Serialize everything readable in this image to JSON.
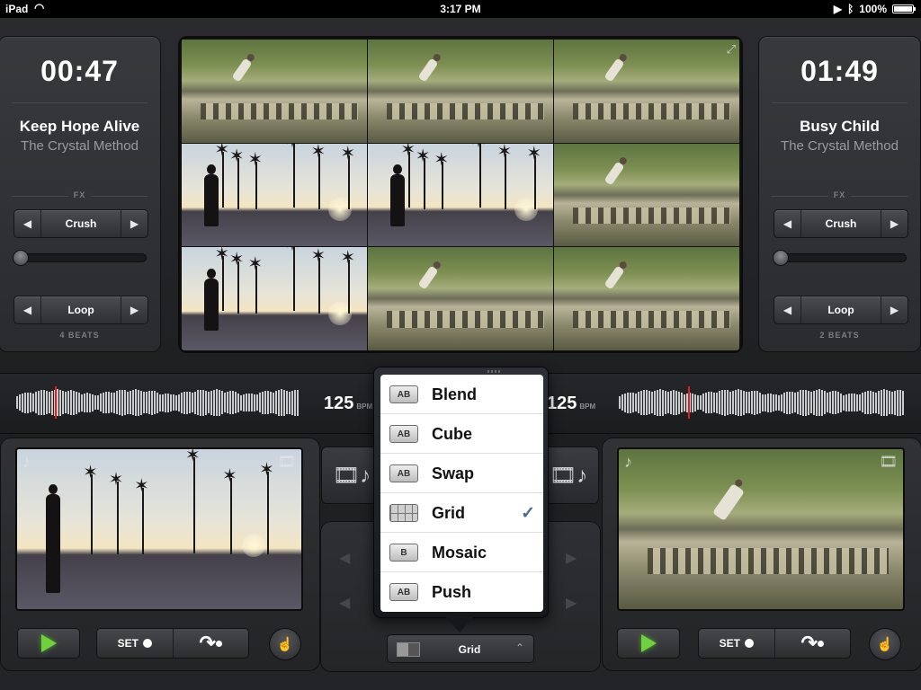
{
  "status_bar": {
    "device": "iPad",
    "time": "3:17 PM",
    "battery": "100%"
  },
  "deck_left": {
    "time": "00:47",
    "title": "Keep Hope Alive",
    "artist": "The Crystal Method",
    "fx_label": "FX",
    "fx_value": "Crush",
    "fx_level": 0,
    "loop_value": "Loop",
    "beats": "4 BEATS",
    "bpm": "125",
    "bpm_unit": "BPM"
  },
  "deck_right": {
    "time": "01:49",
    "title": "Busy Child",
    "artist": "The Crystal Method",
    "fx_label": "FX",
    "fx_value": "Crush",
    "fx_level": 0,
    "loop_value": "Loop",
    "beats": "2 BEATS",
    "bpm": "125",
    "bpm_unit": "BPM"
  },
  "controls": {
    "set_label": "SET"
  },
  "video_grid": {
    "tiles": [
      "skate-ledge",
      "skate-ledge",
      "skate-ledge",
      "palm-sunset",
      "palm-sunset",
      "skate-ledge",
      "palm-sunset",
      "skate-ledge",
      "skate-ledge"
    ]
  },
  "transitions": {
    "selected": "Grid",
    "options": [
      {
        "label": "Blend",
        "icon": "AB"
      },
      {
        "label": "Cube",
        "icon": "AB"
      },
      {
        "label": "Swap",
        "icon": "AB"
      },
      {
        "label": "Grid",
        "icon": ""
      },
      {
        "label": "Mosaic",
        "icon": "B"
      },
      {
        "label": "Push",
        "icon": "AB"
      }
    ]
  },
  "icons": {
    "left_arrow": "◀",
    "right_arrow": "▶",
    "music_note": "♪",
    "film": "🎞",
    "check": "✓",
    "cue_arrow": "↷",
    "expand": "⤢"
  },
  "colors": {
    "accent_play": "#6ed23d",
    "playhead": "#e0201c",
    "check": "#4b6b97"
  }
}
